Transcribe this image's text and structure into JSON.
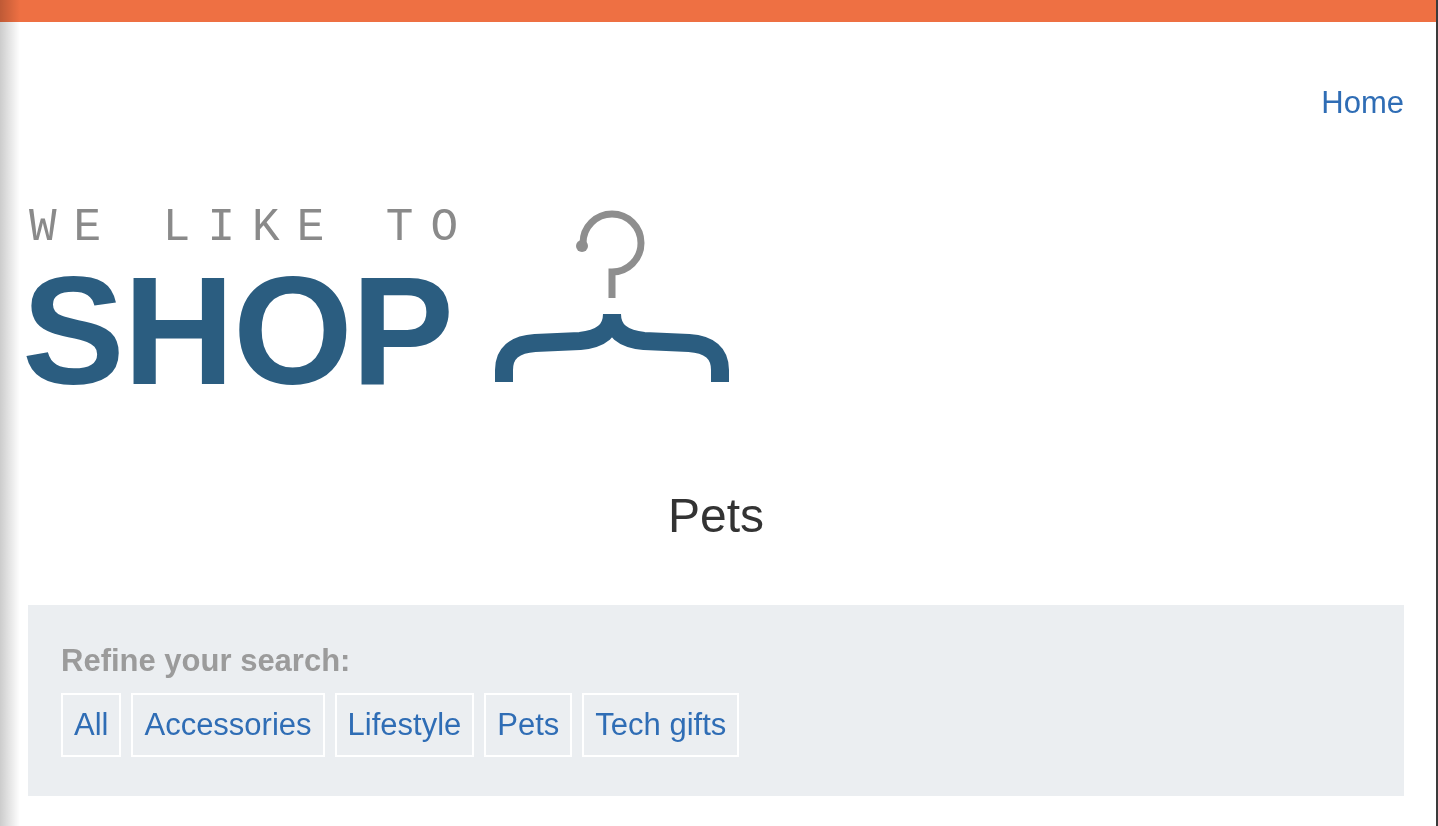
{
  "header": {
    "nav_links": [
      "Home"
    ]
  },
  "logo": {
    "tagline": "WE LIKE TO",
    "wordmark": "SHOP"
  },
  "page_title": "Pets",
  "filters": {
    "label": "Refine your search:",
    "options": [
      "All",
      "Accessories",
      "Lifestyle",
      "Pets",
      "Tech gifts"
    ]
  }
}
